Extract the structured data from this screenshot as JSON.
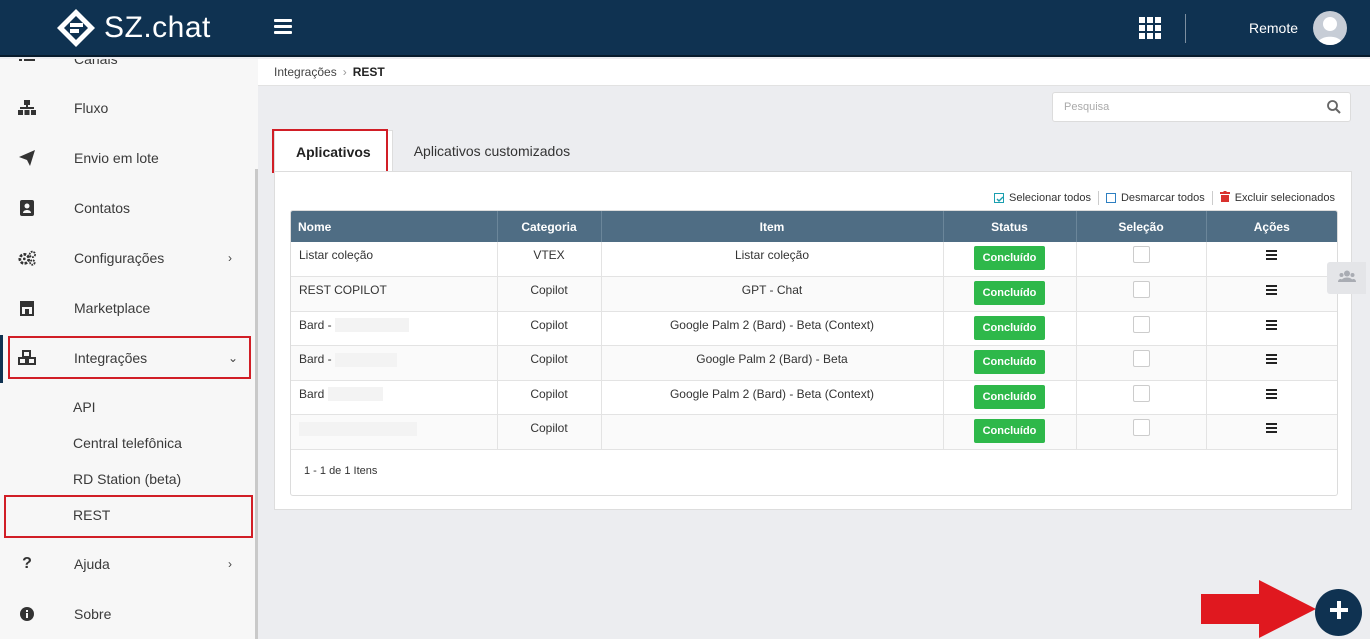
{
  "app": {
    "logo_text": "SZ.chat",
    "user_name": "Remote"
  },
  "sidebar": {
    "items": [
      {
        "label": "Canais",
        "icon": "list-icon"
      },
      {
        "label": "Fluxo",
        "icon": "sitemap-icon"
      },
      {
        "label": "Envio em lote",
        "icon": "paper-plane-icon"
      },
      {
        "label": "Contatos",
        "icon": "contact-book-icon"
      },
      {
        "label": "Configurações",
        "icon": "gears-icon"
      },
      {
        "label": "Marketplace",
        "icon": "store-icon"
      },
      {
        "label": "Integrações",
        "icon": "cubes-icon"
      },
      {
        "label": "Ajuda",
        "icon": "question-icon"
      },
      {
        "label": "Sobre",
        "icon": "info-icon"
      }
    ],
    "sub_items": [
      {
        "label": "API"
      },
      {
        "label": "Central telefônica"
      },
      {
        "label": "RD Station (beta)"
      },
      {
        "label": "REST"
      }
    ]
  },
  "breadcrumb": {
    "parent": "Integrações",
    "current": "REST"
  },
  "search": {
    "placeholder": "Pesquisa"
  },
  "tabs": [
    {
      "label": "Aplicativos",
      "active": true
    },
    {
      "label": "Aplicativos customizados",
      "active": false
    }
  ],
  "bulk_actions": {
    "select_all": "Selecionar todos",
    "deselect_all": "Desmarcar todos",
    "delete_selected": "Excluir selecionados"
  },
  "table": {
    "columns": [
      "Nome",
      "Categoria",
      "Item",
      "Status",
      "Seleção",
      "Ações"
    ],
    "rows": [
      {
        "name": "Listar coleção",
        "category": "VTEX",
        "item": "Listar coleção",
        "status": "Concluído"
      },
      {
        "name": "REST COPILOT",
        "category": "Copilot",
        "item": "GPT - Chat",
        "status": "Concluído"
      },
      {
        "name": "Bard -",
        "category": "Copilot",
        "item": "Google Palm 2 (Bard) - Beta (Context)",
        "status": "Concluído"
      },
      {
        "name": "Bard -",
        "category": "Copilot",
        "item": "Google Palm 2 (Bard) - Beta",
        "status": "Concluído"
      },
      {
        "name": "Bard",
        "category": "Copilot",
        "item": "Google Palm 2 (Bard) - Beta (Context)",
        "status": "Concluído"
      },
      {
        "name": "",
        "category": "Copilot",
        "item": "",
        "status": "Concluído"
      }
    ],
    "pagination": "1 - 1 de 1 Itens"
  },
  "colors": {
    "topbar": "#0f3251",
    "header": "#4f6d84",
    "status_green": "#2eb84a",
    "highlight_red": "#d11e26"
  }
}
